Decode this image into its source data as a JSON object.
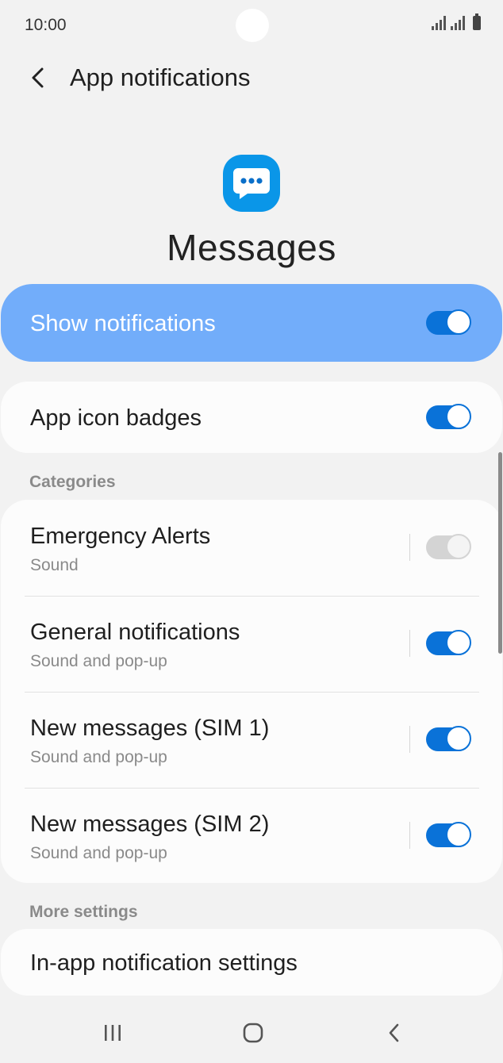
{
  "status_bar": {
    "time": "10:00"
  },
  "header": {
    "title": "App notifications"
  },
  "app": {
    "name": "Messages",
    "icon": "chat-bubble-icon",
    "icon_color": "#0a96e8"
  },
  "show_notifications": {
    "label": "Show notifications",
    "enabled": true
  },
  "app_icon_badges": {
    "label": "App icon badges",
    "enabled": true
  },
  "categories": {
    "label": "Categories",
    "items": [
      {
        "title": "Emergency Alerts",
        "subtitle": "Sound",
        "enabled": true,
        "disabled": true
      },
      {
        "title": "General notifications",
        "subtitle": "Sound and pop-up",
        "enabled": true,
        "disabled": false
      },
      {
        "title": "New messages (SIM 1)",
        "subtitle": "Sound and pop-up",
        "enabled": true,
        "disabled": false
      },
      {
        "title": "New messages (SIM 2)",
        "subtitle": "Sound and pop-up",
        "enabled": true,
        "disabled": false
      }
    ]
  },
  "more_settings": {
    "label": "More settings",
    "in_app_label": "In-app notification settings"
  },
  "colors": {
    "accent": "#0a72d8",
    "highlight": "#72adfa",
    "background": "#f2f2f2"
  }
}
